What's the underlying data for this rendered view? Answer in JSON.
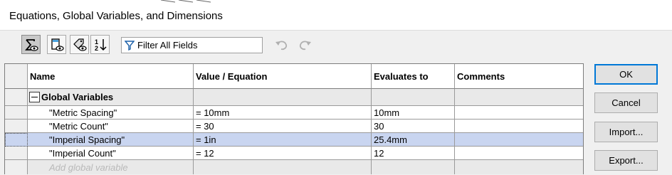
{
  "window": {
    "title": "Equations, Global Variables, and Dimensions"
  },
  "toolbar": {
    "buttons": [
      {
        "icon": "sigma-eye-icon",
        "active": true
      },
      {
        "icon": "sheet-eye-icon",
        "active": false
      },
      {
        "icon": "tag-eye-icon",
        "active": false
      },
      {
        "icon": "sort-order-icon",
        "active": false
      }
    ],
    "filter_placeholder": "Filter All Fields",
    "undo_icon": "undo-icon",
    "redo_icon": "redo-icon"
  },
  "table": {
    "headers": [
      "Name",
      "Value / Equation",
      "Evaluates to",
      "Comments"
    ],
    "group_label": "Global Variables",
    "rows": [
      {
        "name": "\"Metric Spacing\"",
        "value": "= 10mm",
        "evaluates": "10mm",
        "comments": ""
      },
      {
        "name": "\"Metric Count\"",
        "value": "= 30",
        "evaluates": "30",
        "comments": ""
      },
      {
        "name": "\"Imperial Spacing\"",
        "value": "= 1in",
        "evaluates": "25.4mm",
        "comments": ""
      },
      {
        "name": "\"Imperial Count\"",
        "value": "= 12",
        "evaluates": "12",
        "comments": ""
      }
    ],
    "add_placeholder": "Add global variable",
    "selected_row_index": 2
  },
  "actions": {
    "ok": "OK",
    "cancel": "Cancel",
    "import": "Import...",
    "export": "Export..."
  }
}
